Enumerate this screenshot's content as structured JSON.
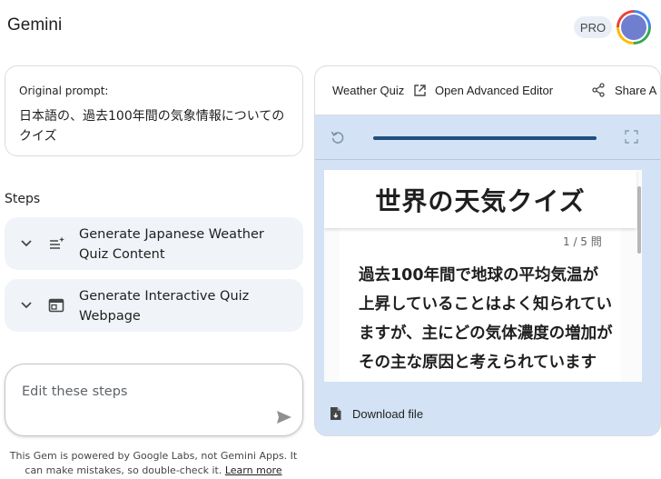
{
  "app": {
    "title": "Gemini",
    "badge": "PRO"
  },
  "prompt": {
    "label": "Original prompt:",
    "text": "日本語の、過去100年間の気象情報についてのクイズ"
  },
  "steps": {
    "title": "Steps",
    "items": [
      {
        "label": "Generate Japanese Weather Quiz Content",
        "icon": "list-sparkle-icon"
      },
      {
        "label": "Generate Interactive Quiz Webpage",
        "icon": "web-page-icon"
      }
    ]
  },
  "editor": {
    "placeholder": "Edit these steps"
  },
  "footer": {
    "text": "This Gem is powered by Google Labs, not Gemini Apps. It can make mistakes, so double-check it.",
    "link": "Learn more"
  },
  "preview": {
    "title": "Weather Quiz",
    "open_label": "Open Advanced Editor",
    "share_label": "Share A",
    "progress": 1.0,
    "download_label": "Download file"
  },
  "quiz": {
    "title": "世界の天気クイズ",
    "count": "1 / 5 問",
    "question": "過去100年間で地球の平均気温が上昇していることはよく知られていますが、主にどの気体濃度の増加がその主な原因と考えられていますか？"
  },
  "colors": {
    "panel_bg": "#d3e2f5",
    "step_bg": "#f0f4f9",
    "progress_fill": "#1f4f7e",
    "avatar": "#6f7ecf"
  }
}
